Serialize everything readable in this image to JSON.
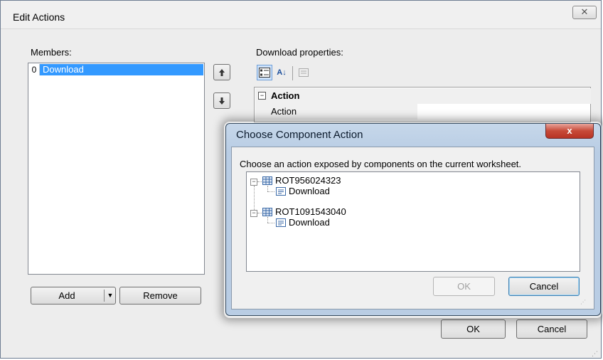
{
  "outer_dialog": {
    "title": "Edit Actions",
    "close_glyph": "✕",
    "members_label": "Members:",
    "members": [
      {
        "index": "0",
        "name": "Download"
      }
    ],
    "up_icon": "arrow-up-icon",
    "down_icon": "arrow-down-icon",
    "add_label": "Add",
    "remove_label": "Remove",
    "properties_label": "Download properties:",
    "property_grid": {
      "category": "Action",
      "category_toggle": "⊟",
      "properties": [
        {
          "name": "Action",
          "value": ""
        }
      ]
    },
    "ok_label": "OK",
    "cancel_label": "Cancel"
  },
  "inner_dialog": {
    "title": "Choose Component Action",
    "close_glyph": "x",
    "description": "Choose an action exposed by components on the current worksheet.",
    "tree": [
      {
        "name": "ROT956024323",
        "children": [
          {
            "name": "Download"
          }
        ]
      },
      {
        "name": "ROT1091543040",
        "children": [
          {
            "name": "Download"
          }
        ]
      }
    ],
    "ok_label": "OK",
    "cancel_label": "Cancel"
  },
  "colors": {
    "selection": "#3399ff",
    "inner_frame": "#b9cde4",
    "close_red": "#c74a38"
  }
}
